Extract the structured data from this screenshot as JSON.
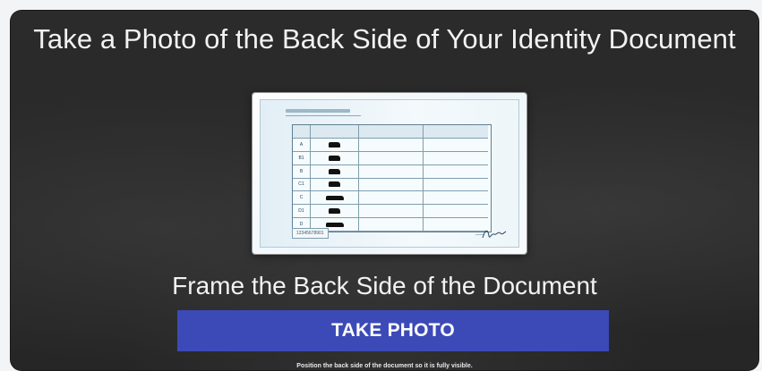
{
  "screen": {
    "title": "Take a Photo of the Back Side of Your Identity Document",
    "instruction": "Frame the Back Side of the Document",
    "take_photo_label": "TAKE PHOTO",
    "hint": "Position the back side of the document so it is fully visible."
  },
  "document_preview": {
    "icon": "id-card-back-image",
    "table_rows": [
      {
        "code": "A"
      },
      {
        "code": "B1"
      },
      {
        "code": "B"
      },
      {
        "code": "C1"
      },
      {
        "code": "C"
      },
      {
        "code": "D1"
      },
      {
        "code": "D"
      }
    ],
    "footer_code": "12345678901"
  },
  "colors": {
    "background": "#2c2c2c",
    "button": "#3c4ab8",
    "text": "#f2f2f2"
  }
}
